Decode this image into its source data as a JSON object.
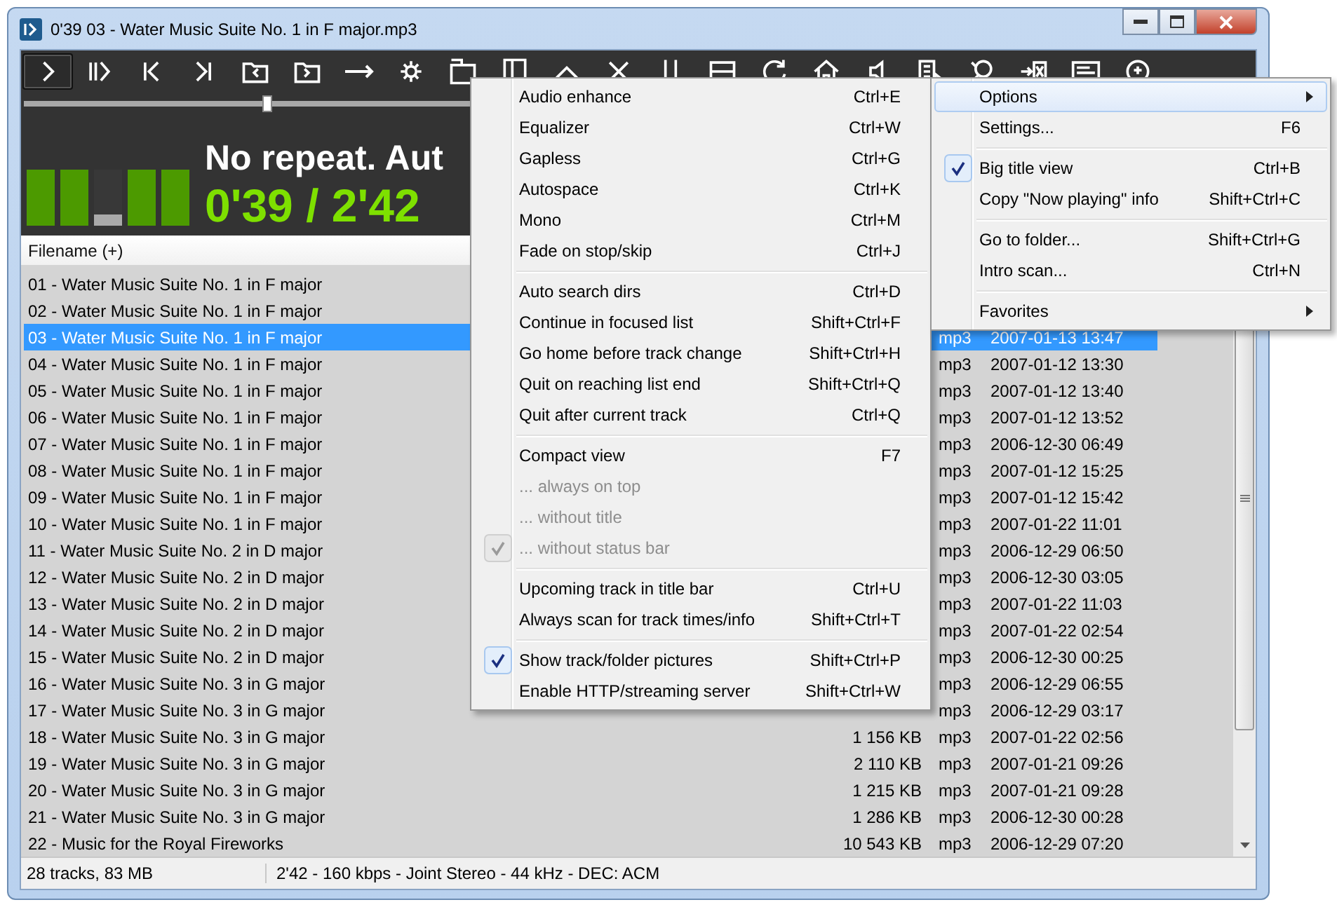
{
  "window": {
    "title": "0'39 03 - Water Music Suite No. 1 in F major.mp3"
  },
  "toolbar": {
    "buttons": [
      {
        "selected": true
      },
      {
        "selected": false
      },
      {
        "selected": false
      },
      {
        "selected": false
      },
      {
        "selected": false
      },
      {
        "selected": false
      },
      {
        "selected": false
      },
      {
        "selected": false
      },
      {
        "selected": false
      },
      {
        "selected": false
      },
      {
        "selected": false
      },
      {
        "selected": false
      },
      {
        "selected": false
      },
      {
        "selected": false
      },
      {
        "selected": false
      },
      {
        "selected": false
      },
      {
        "selected": false
      },
      {
        "selected": false
      },
      {
        "selected": false
      },
      {
        "selected": false
      },
      {
        "selected": false
      },
      {
        "selected": false
      }
    ]
  },
  "seek_slider": {
    "level": 0.2
  },
  "meter": [
    {
      "level": 1
    },
    {
      "level": 1
    },
    {
      "level": 0.2
    },
    {
      "level": 1
    },
    {
      "level": 1
    }
  ],
  "player": {
    "mode_text": "No repeat. Aut",
    "time": "0'39 / 2'42"
  },
  "table": {
    "columns": [
      "Filename (+)"
    ],
    "rows": [
      {
        "filename": "01 - Water Music Suite No. 1 in F major",
        "selected": false
      },
      {
        "filename": "02 - Water Music Suite No. 1 in F major",
        "selected": false
      },
      {
        "filename": "03 - Water Music Suite No. 1 in F major",
        "type": "mp3",
        "date": "2007-01-13 13:47",
        "selected": true
      },
      {
        "filename": "04 - Water Music Suite No. 1 in F major",
        "type": "mp3",
        "date": "2007-01-12 13:30",
        "selected": false
      },
      {
        "filename": "05 - Water Music Suite No. 1 in F major",
        "type": "mp3",
        "date": "2007-01-12 13:40",
        "selected": false
      },
      {
        "filename": "06 - Water Music Suite No. 1 in F major",
        "type": "mp3",
        "date": "2007-01-12 13:52",
        "selected": false
      },
      {
        "filename": "07 - Water Music Suite No. 1 in F major",
        "type": "mp3",
        "date": "2006-12-30 06:49",
        "selected": false
      },
      {
        "filename": "08 - Water Music Suite No. 1 in F major",
        "type": "mp3",
        "date": "2007-01-12 15:25",
        "selected": false
      },
      {
        "filename": "09 - Water Music Suite No. 1 in F major",
        "type": "mp3",
        "date": "2007-01-12 15:42",
        "selected": false
      },
      {
        "filename": "10 - Water Music Suite No. 1 in F major",
        "type": "mp3",
        "date": "2007-01-22 11:01",
        "selected": false
      },
      {
        "filename": "11 - Water Music Suite No. 2 in D major",
        "type": "mp3",
        "date": "2006-12-29 06:50",
        "selected": false
      },
      {
        "filename": "12 - Water Music Suite No. 2 in D major",
        "type": "mp3",
        "date": "2006-12-30 03:05",
        "selected": false
      },
      {
        "filename": "13 - Water Music Suite No. 2 in D major",
        "type": "mp3",
        "date": "2007-01-22 11:03",
        "selected": false
      },
      {
        "filename": "14 - Water Music Suite No. 2 in D major",
        "type": "mp3",
        "date": "2007-01-22 02:54",
        "selected": false
      },
      {
        "filename": "15 - Water Music Suite No. 2 in D major",
        "type": "mp3",
        "date": "2006-12-30 00:25",
        "selected": false
      },
      {
        "filename": "16 - Water Music Suite No. 3 in G major",
        "type": "mp3",
        "date": "2006-12-29 06:55",
        "selected": false
      },
      {
        "filename": "17 - Water Music Suite No. 3 in G major",
        "type": "mp3",
        "date": "2006-12-29 03:17",
        "selected": false
      },
      {
        "filename": "18 - Water Music Suite No. 3 in G major",
        "size": "1 156 KB",
        "type": "mp3",
        "date": "2007-01-22 02:56",
        "selected": false
      },
      {
        "filename": "19 - Water Music Suite No. 3 in G major",
        "size": "2 110 KB",
        "type": "mp3",
        "date": "2007-01-21 09:26",
        "selected": false
      },
      {
        "filename": "20 - Water Music Suite No. 3 in G major",
        "size": "1 215 KB",
        "type": "mp3",
        "date": "2007-01-21 09:28",
        "selected": false
      },
      {
        "filename": "21 - Water Music Suite No. 3 in G major",
        "size": "1 286 KB",
        "type": "mp3",
        "date": "2006-12-30 00:28",
        "selected": false
      },
      {
        "filename": "22 - Music for the Royal Fireworks",
        "size": "10 543 KB",
        "type": "mp3",
        "date": "2006-12-29 07:20",
        "selected": false
      }
    ]
  },
  "status_bar": [
    "28 tracks, 83 MB",
    "2'42 - 160 kbps - Joint Stereo - 44 kHz - DEC: ACM"
  ],
  "context_menu": {
    "items": [
      {
        "kind": "item",
        "label": "Audio enhance",
        "shortcut": "Ctrl+E",
        "checked": false,
        "disabled": false,
        "selected": false
      },
      {
        "kind": "item",
        "label": "Equalizer",
        "shortcut": "Ctrl+W",
        "checked": false,
        "disabled": false,
        "selected": false
      },
      {
        "kind": "item",
        "label": "Gapless",
        "shortcut": "Ctrl+G",
        "checked": false,
        "disabled": false,
        "selected": false
      },
      {
        "kind": "item",
        "label": "Autospace",
        "shortcut": "Ctrl+K",
        "checked": false,
        "disabled": false,
        "selected": false
      },
      {
        "kind": "item",
        "label": "Mono",
        "shortcut": "Ctrl+M",
        "checked": false,
        "disabled": false,
        "selected": false
      },
      {
        "kind": "item",
        "label": "Fade on stop/skip",
        "shortcut": "Ctrl+J",
        "checked": false,
        "disabled": false,
        "selected": false
      },
      {
        "kind": "separator"
      },
      {
        "kind": "item",
        "label": "Auto search dirs",
        "shortcut": "Ctrl+D",
        "checked": false,
        "disabled": false,
        "selected": false
      },
      {
        "kind": "item",
        "label": "Continue in focused list",
        "shortcut": "Shift+Ctrl+F",
        "checked": false,
        "disabled": false,
        "selected": false
      },
      {
        "kind": "item",
        "label": "Go home before track change",
        "shortcut": "Shift+Ctrl+H",
        "checked": false,
        "disabled": false,
        "selected": false
      },
      {
        "kind": "item",
        "label": "Quit on reaching list end",
        "shortcut": "Shift+Ctrl+Q",
        "checked": false,
        "disabled": false,
        "selected": false
      },
      {
        "kind": "item",
        "label": "Quit after current track",
        "shortcut": "Ctrl+Q",
        "checked": false,
        "disabled": false,
        "selected": false
      },
      {
        "kind": "separator"
      },
      {
        "kind": "item",
        "label": "Compact view",
        "shortcut": "F7",
        "checked": false,
        "disabled": false,
        "selected": false
      },
      {
        "kind": "item",
        "label": "... always on top",
        "checked": false,
        "disabled": true,
        "selected": false
      },
      {
        "kind": "item",
        "label": "... without title",
        "checked": false,
        "disabled": true,
        "selected": false
      },
      {
        "kind": "item",
        "label": "... without status bar",
        "checked": true,
        "disabled": true,
        "selected": false
      },
      {
        "kind": "separator"
      },
      {
        "kind": "item",
        "label": "Upcoming track in title bar",
        "shortcut": "Ctrl+U",
        "checked": false,
        "disabled": false,
        "selected": false
      },
      {
        "kind": "item",
        "label": "Always scan for track times/info",
        "shortcut": "Shift+Ctrl+T",
        "checked": false,
        "disabled": false,
        "selected": false
      },
      {
        "kind": "separator"
      },
      {
        "kind": "item",
        "label": "Show track/folder pictures",
        "shortcut": "Shift+Ctrl+P",
        "checked": true,
        "disabled": false,
        "selected": false
      },
      {
        "kind": "item",
        "label": "Enable HTTP/streaming server",
        "shortcut": "Shift+Ctrl+W",
        "checked": false,
        "disabled": false,
        "selected": false
      }
    ]
  },
  "main_menu": {
    "items": [
      {
        "kind": "submenu",
        "label": "Options",
        "checked": false,
        "disabled": false,
        "selected": true
      },
      {
        "kind": "item",
        "label": "Settings...",
        "shortcut": "F6",
        "checked": false,
        "disabled": false,
        "selected": false
      },
      {
        "kind": "separator"
      },
      {
        "kind": "item",
        "label": "Big title view",
        "shortcut": "Ctrl+B",
        "checked": true,
        "disabled": false,
        "selected": false
      },
      {
        "kind": "item",
        "label": "Copy \"Now playing\" info",
        "shortcut": "Shift+Ctrl+C",
        "checked": false,
        "disabled": false,
        "selected": false
      },
      {
        "kind": "separator"
      },
      {
        "kind": "item",
        "label": "Go to folder...",
        "shortcut": "Shift+Ctrl+G",
        "checked": false,
        "disabled": false,
        "selected": false
      },
      {
        "kind": "item",
        "label": "Intro scan...",
        "shortcut": "Ctrl+N",
        "checked": false,
        "disabled": false,
        "selected": false
      },
      {
        "kind": "separator"
      },
      {
        "kind": "submenu",
        "label": "Favorites",
        "checked": false,
        "disabled": false,
        "selected": false
      }
    ]
  }
}
